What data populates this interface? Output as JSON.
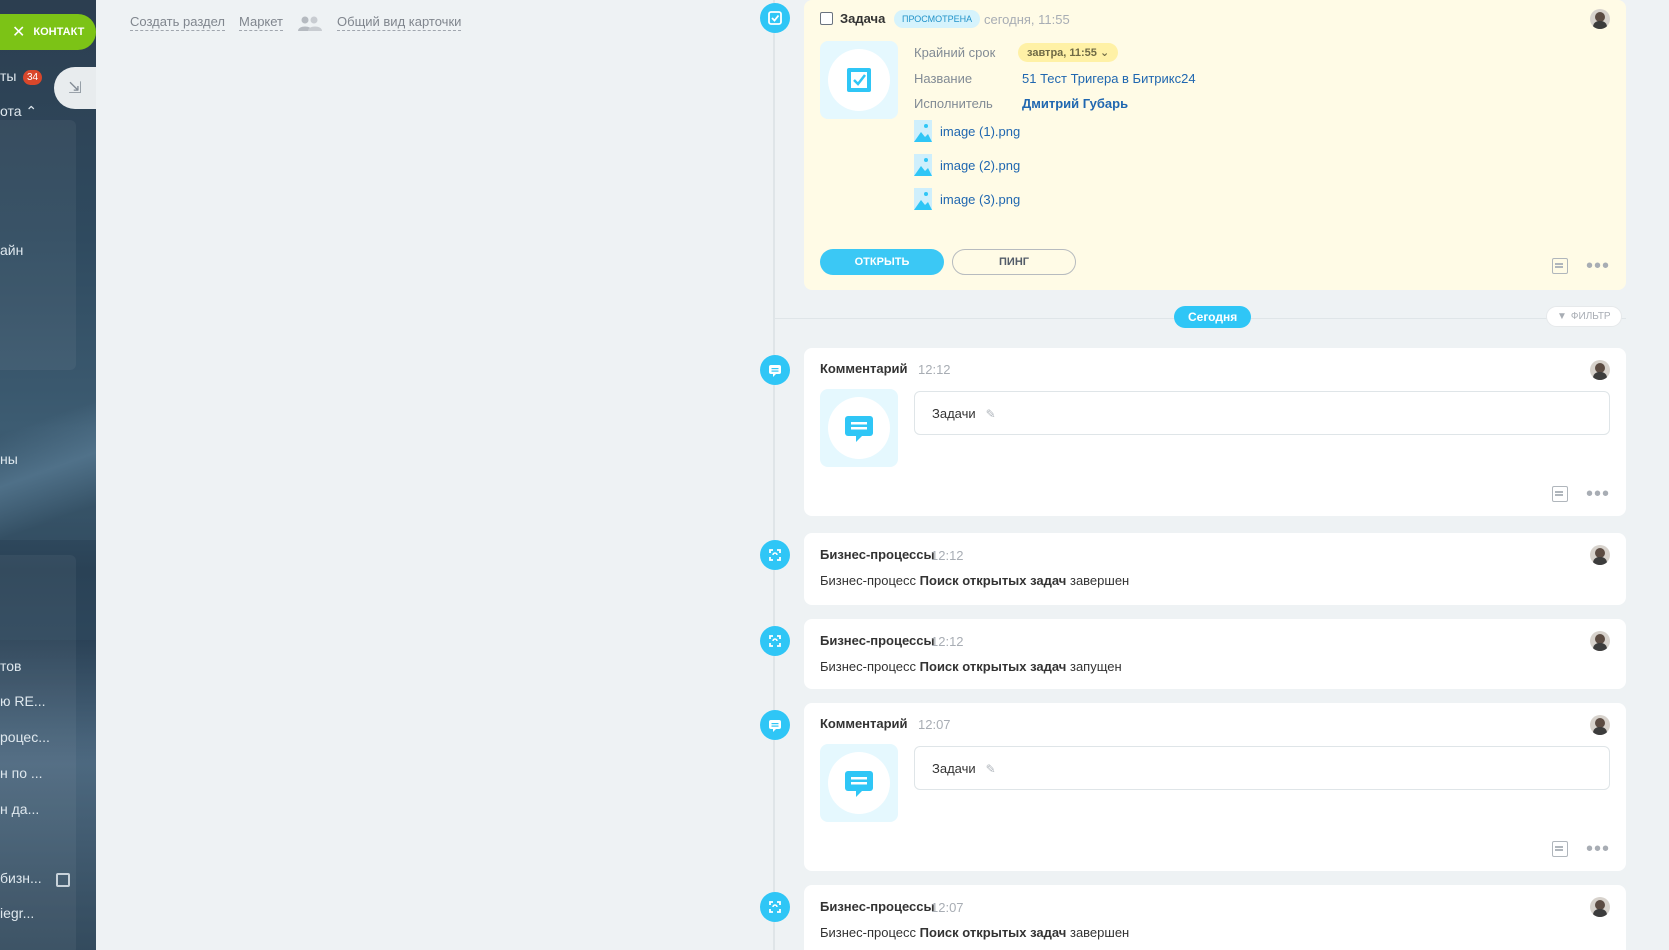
{
  "left_panel": {
    "contact_label": "КОНТАКТ",
    "badge_count": "34",
    "items": [
      "ты",
      "ота",
      "айн",
      "ны",
      "тов",
      "ю RE...",
      "роцес...",
      "н по ...",
      "н да...",
      "бизн...",
      "iegr..."
    ]
  },
  "top_links": {
    "create_section": "Создать раздел",
    "market": "Маркет",
    "card_view": "Общий вид карточки"
  },
  "task": {
    "title": "Задача",
    "status": "просмотрена",
    "time": "сегодня, 11:55",
    "deadline_label": "Крайний срок",
    "deadline_value": "завтра, 11:55",
    "name_label": "Название",
    "name_value": "51 Тест Тригера в Битрикс24",
    "assignee_label": "Исполнитель",
    "assignee_value": "Дмитрий Губарь",
    "files": [
      "image (1).png",
      "image (2).png",
      "image (3).png"
    ],
    "open_label": "открыть",
    "ping_label": "пинг"
  },
  "divider": {
    "today": "Сегодня",
    "filter": "фильтр"
  },
  "comment1": {
    "title": "Комментарий",
    "time": "12:12",
    "text": "Задачи"
  },
  "bp1": {
    "title": "Бизнес-процессы",
    "time": "12:12",
    "prefix": "Бизнес-процесс",
    "name": "Поиск открытых задач",
    "suffix": "завершен"
  },
  "bp2": {
    "title": "Бизнес-процессы",
    "time": "12:12",
    "prefix": "Бизнес-процесс",
    "name": "Поиск открытых задач",
    "suffix": "запущен"
  },
  "comment2": {
    "title": "Комментарий",
    "time": "12:07",
    "text": "Задачи"
  },
  "bp3": {
    "title": "Бизнес-процессы",
    "time": "12:07",
    "prefix": "Бизнес-процесс",
    "name": "Поиск открытых задач",
    "suffix": "завершен"
  },
  "colors": {
    "accent": "#2fc6f6",
    "green": "#7cc316",
    "link": "#2067b0",
    "task_bg": "#fffbe6"
  }
}
